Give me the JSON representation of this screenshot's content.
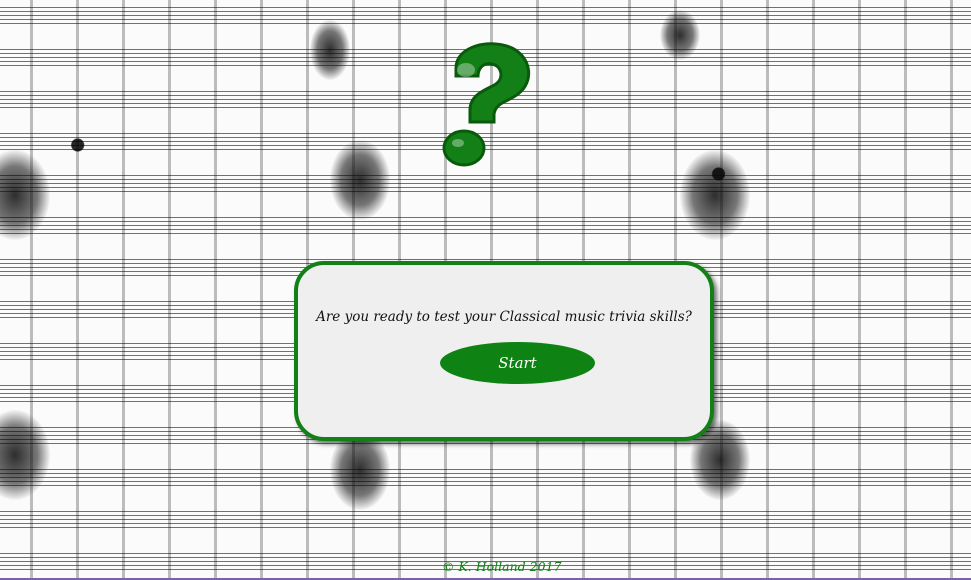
{
  "page": {
    "background": "sheet-music-pattern",
    "accent_color": "#138017",
    "button_color": "#0e8212"
  },
  "hero": {
    "icon": "question-mark-icon"
  },
  "card": {
    "prompt": "Are you ready to test your Classical music trivia skills?",
    "start_label": "Start"
  },
  "footer": {
    "credit": "© K. Holland 2017"
  }
}
